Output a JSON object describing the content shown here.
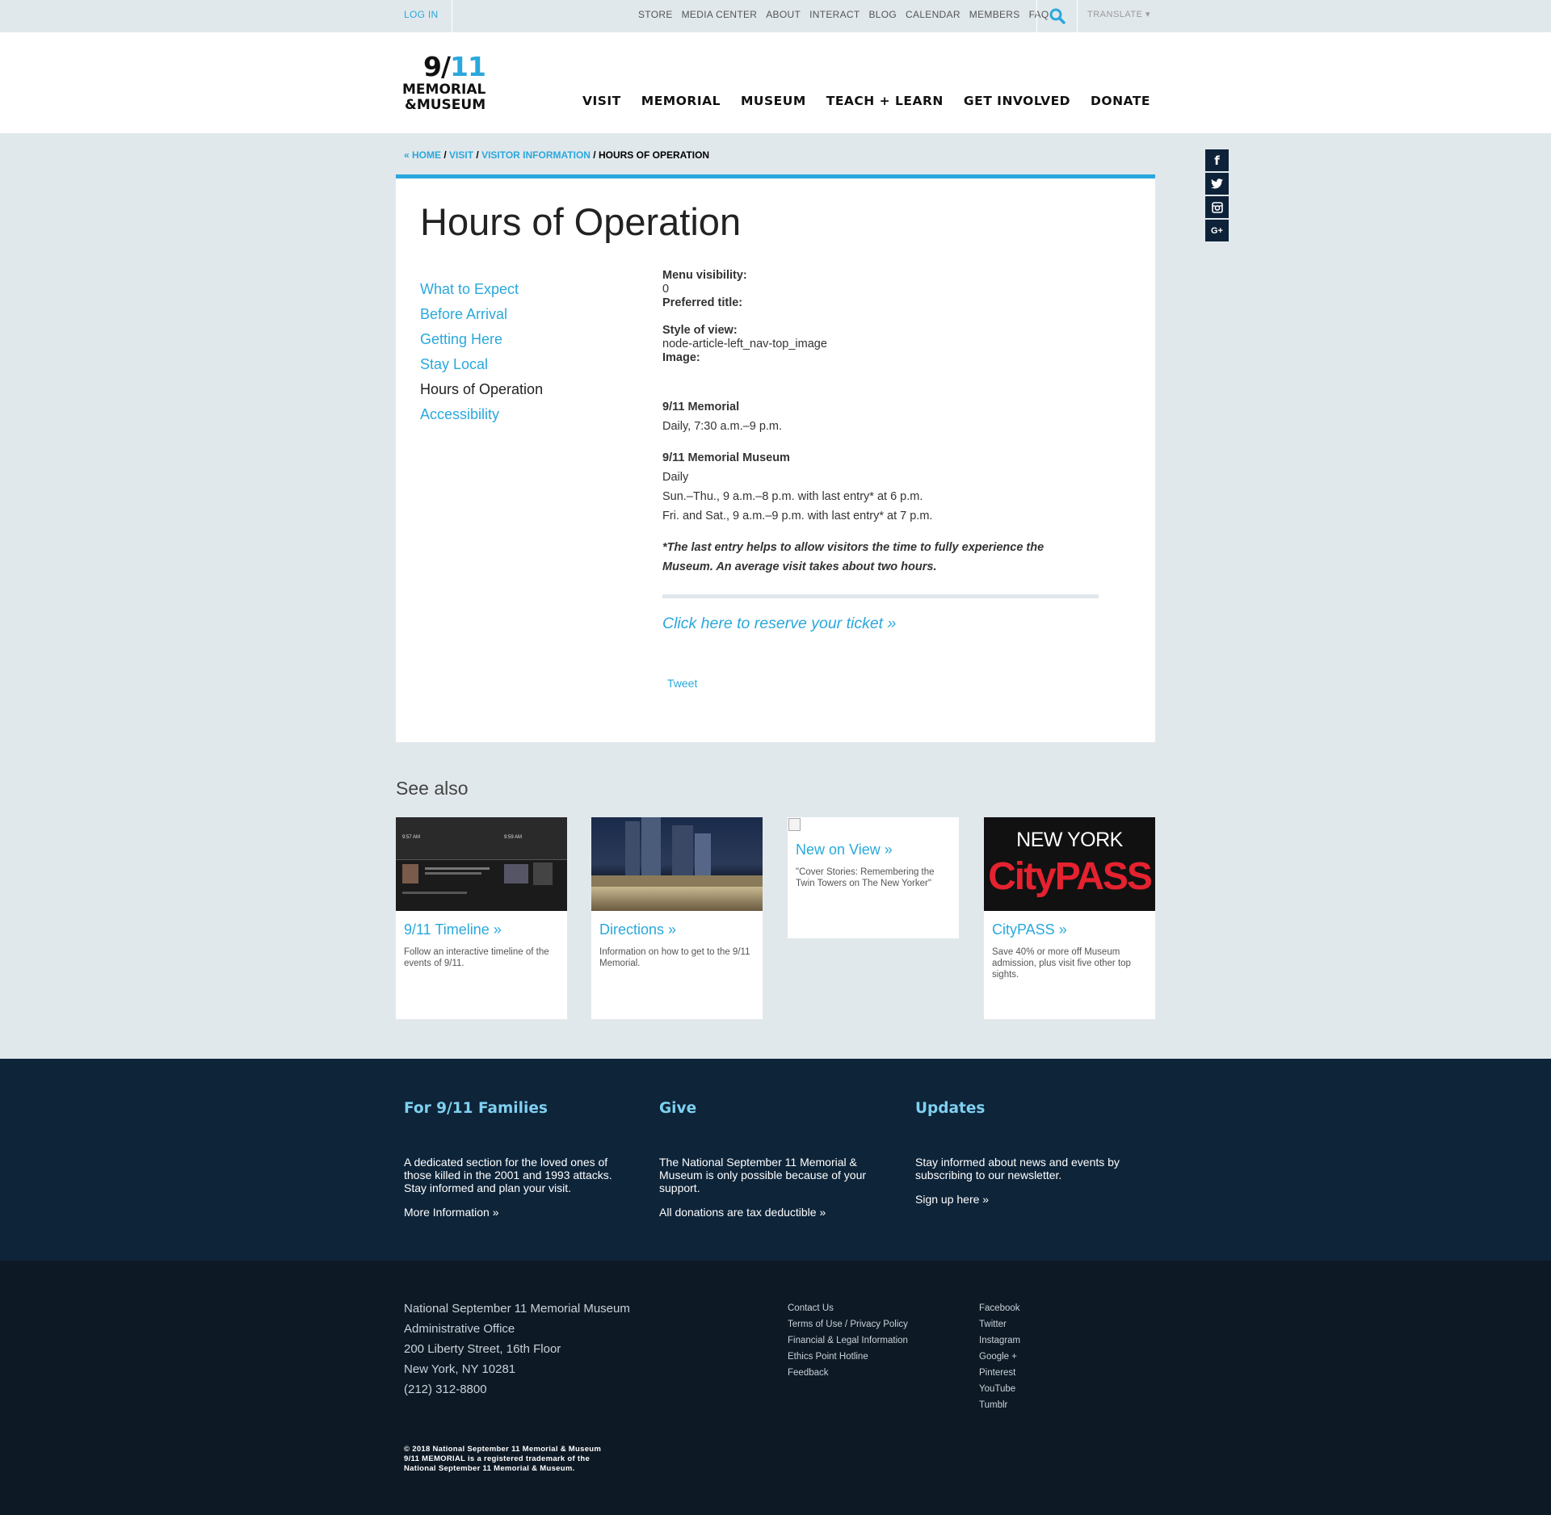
{
  "utility": {
    "login": "LOG IN",
    "links": [
      "STORE",
      "MEDIA CENTER",
      "ABOUT",
      "INTERACT",
      "BLOG",
      "CALENDAR",
      "MEMBERS",
      "FAQ"
    ],
    "translate": "TRANSLATE ▾"
  },
  "logo": {
    "line1": "9/",
    "line1b": "11",
    "line2": "MEMORIAL",
    "line3": "&MUSEUM"
  },
  "mainnav": [
    "VISIT",
    "MEMORIAL",
    "MUSEUM",
    "TEACH + LEARN",
    "GET INVOLVED",
    "DONATE"
  ],
  "breadcrumb": {
    "home": "« HOME",
    "visit": "VISIT",
    "visitor_info": "VISITOR INFORMATION",
    "current": "HOURS OF OPERATION",
    "sep": " / "
  },
  "social": {
    "facebook": "f",
    "twitter": "t",
    "instagram": "◎",
    "googleplus": "G+"
  },
  "page": {
    "title": "Hours of Operation",
    "leftnav": [
      "What to Expect",
      "Before Arrival",
      "Getting Here",
      "Stay Local",
      "Hours of Operation",
      "Accessibility"
    ],
    "meta": {
      "menu_visibility_label": "Menu visibility:",
      "menu_visibility_value": "0",
      "preferred_title_label": "Preferred title:",
      "style_label": "Style of view:",
      "style_value": "node-article-left_nav-top_image",
      "image_label": "Image:"
    },
    "memorial_heading": "9/11 Memorial",
    "memorial_hours": "Daily, 7:30 a.m.–9 p.m.",
    "museum_heading": "9/11 Memorial Museum",
    "museum_daily": "Daily",
    "museum_weekday": "Sun.–Thu., 9 a.m.–8 p.m. with last entry* at 6 p.m.",
    "museum_weekend": "Fri. and Sat., 9 a.m.–9 p.m. with last entry* at 7 p.m.",
    "note": "*The last entry helps to allow visitors the time to fully experience the Museum. An average visit takes about two hours.",
    "reserve": "Click here to reserve your ticket »",
    "tweet": "Tweet"
  },
  "seealso": {
    "heading": "See also",
    "tiles": [
      {
        "title": "9/11 Timeline »",
        "desc": "Follow an interactive timeline of the events of 9/11.",
        "img_t1": "9:57 AM",
        "img_t2": "9:59 AM"
      },
      {
        "title": "Directions »",
        "desc": "Information on how to get to the 9/11 Memorial."
      },
      {
        "title": "New on View »",
        "desc": "\"Cover Stories: Remembering the Twin Towers on The New Yorker\""
      },
      {
        "title": "CityPASS »",
        "desc": "Save 40% or more off Museum admission, plus visit five other top sights.",
        "img_l1": "NEW YORK",
        "img_l2": "CityPASS"
      }
    ]
  },
  "footer": {
    "families": {
      "title": "For 9/11 Families",
      "text": "A dedicated section for the loved ones of those killed in the 2001 and 1993 attacks. Stay informed and plan your visit.",
      "link": "More Information »"
    },
    "give": {
      "title": "Give",
      "text": "The National September 11 Memorial & Museum is only possible because of your support.",
      "link": "All donations are tax deductible »"
    },
    "updates": {
      "title": "Updates",
      "text": "Stay informed about news and events by subscribing to our newsletter.",
      "link": "Sign up here »"
    },
    "address": [
      "National September 11 Memorial Museum",
      "Administrative Office",
      "200 Liberty Street, 16th Floor",
      "New York, NY 10281",
      "(212) 312-8800"
    ],
    "links1": [
      "Contact Us",
      "Terms of Use / Privacy Policy",
      "Financial & Legal Information",
      "Ethics Point Hotline",
      "Feedback"
    ],
    "links2": [
      "Facebook",
      "Twitter",
      "Instagram",
      "Google +",
      "Pinterest",
      "YouTube",
      "Tumblr"
    ],
    "copyright": [
      "© 2018 National September 11 Memorial & Museum",
      "9/11 MEMORIAL is a registered trademark of the",
      "National September 11 Memorial & Museum."
    ]
  },
  "colors": {
    "accent": "#2aa8dc",
    "footer_blue": "#0e2439",
    "footer_dark": "#0d1925",
    "page_bg": "#e1e8ec"
  }
}
